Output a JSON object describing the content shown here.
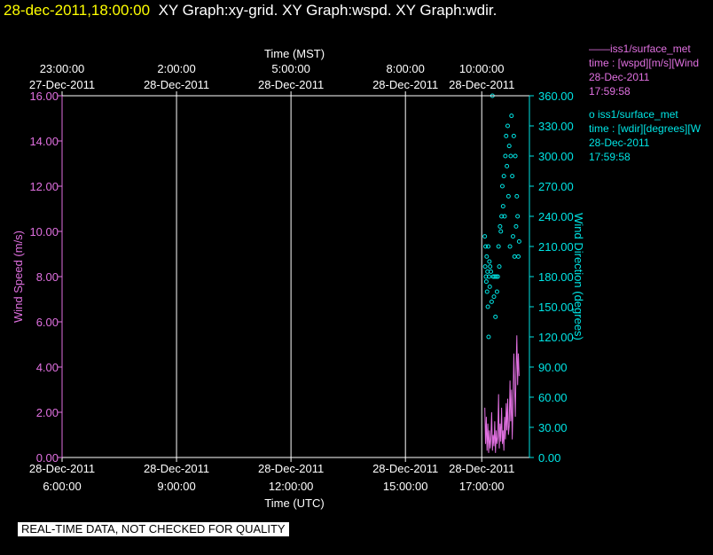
{
  "header": {
    "timestamp": "28-dec-2011,18:00:00",
    "title": "XY Graph:xy-grid.  XY Graph:wspd.  XY Graph:wdir."
  },
  "legend": [
    {
      "symbol": "line",
      "name": "——iss1/surface_met",
      "lines": [
        "time : [wspd][m/s][Wind",
        "28-Dec-2011",
        "17:59:58"
      ],
      "color": "#e070e0"
    },
    {
      "symbol": "circle",
      "name": "o  iss1/surface_met",
      "lines": [
        "time : [wdir][degrees][W",
        "28-Dec-2011",
        "17:59:58"
      ],
      "color": "#00e5e5"
    }
  ],
  "disclaimer": "REAL-TIME DATA, NOT CHECKED FOR QUALITY",
  "chart_data": {
    "type": "scatter",
    "title": "",
    "xlabel_top": "Time (MST)",
    "xlabel_bottom": "Time (UTC)",
    "ylabel_left": "Wind Speed (m/s)",
    "ylabel_right": "Wind Direction (degrees)",
    "xlim_utc_hours": [
      6,
      18.25
    ],
    "ylim_left": [
      0,
      16
    ],
    "ylim_right": [
      0,
      360
    ],
    "yticks_left": [
      "0.00",
      "2.00",
      "4.00",
      "6.00",
      "8.00",
      "10.00",
      "12.00",
      "14.00",
      "16.00"
    ],
    "yticks_right": [
      "0.00",
      "30.00",
      "60.00",
      "90.00",
      "120.00",
      "150.00",
      "180.00",
      "210.00",
      "240.00",
      "270.00",
      "300.00",
      "330.00",
      "360.00"
    ],
    "xticks_bottom": [
      {
        "hour": 6,
        "date": "28-Dec-2011",
        "time": "6:00:00"
      },
      {
        "hour": 9,
        "date": "28-Dec-2011",
        "time": "9:00:00"
      },
      {
        "hour": 12,
        "date": "28-Dec-2011",
        "time": "12:00:00"
      },
      {
        "hour": 15,
        "date": "28-Dec-2011",
        "time": "15:00:00"
      },
      {
        "hour": 17,
        "date": "28-Dec-2011",
        "time": "17:00:00"
      }
    ],
    "xticks_top": [
      {
        "hour": 6,
        "time": "23:00:00",
        "date": "27-Dec-2011"
      },
      {
        "hour": 9,
        "time": "2:00:00",
        "date": "28-Dec-2011"
      },
      {
        "hour": 12,
        "time": "5:00:00",
        "date": "28-Dec-2011"
      },
      {
        "hour": 15,
        "time": "8:00:00",
        "date": "28-Dec-2011"
      },
      {
        "hour": 17,
        "time": "10:00:00",
        "date": "28-Dec-2011"
      }
    ],
    "grid": true,
    "series": [
      {
        "name": "iss1/surface_met time : [wspd][m/s]",
        "axis": "left",
        "mode": "line",
        "color": "#e070e0",
        "x": [
          17.08,
          17.1,
          17.12,
          17.14,
          17.16,
          17.18,
          17.2,
          17.22,
          17.24,
          17.26,
          17.28,
          17.3,
          17.32,
          17.34,
          17.36,
          17.38,
          17.4,
          17.42,
          17.44,
          17.46,
          17.48,
          17.5,
          17.52,
          17.54,
          17.56,
          17.58,
          17.6,
          17.62,
          17.64,
          17.66,
          17.68,
          17.7,
          17.72,
          17.74,
          17.76,
          17.78,
          17.8,
          17.82,
          17.84,
          17.86,
          17.88,
          17.9,
          17.92,
          17.94,
          17.96,
          17.98
        ],
        "y": [
          2.2,
          0.6,
          1.8,
          0.3,
          1.5,
          0.2,
          1.2,
          0.4,
          0.8,
          2.0,
          0.3,
          1.0,
          0.5,
          1.6,
          0.2,
          1.2,
          0.6,
          0.9,
          2.8,
          0.4,
          1.5,
          0.7,
          2.2,
          0.6,
          1.2,
          0.3,
          1.8,
          0.8,
          2.4,
          1.2,
          2.6,
          1.0,
          1.4,
          3.4,
          1.6,
          3.0,
          0.8,
          2.4,
          4.6,
          3.2,
          1.8,
          3.8,
          5.4,
          3.2,
          4.6,
          3.6
        ]
      },
      {
        "name": "iss1/surface_met time : [wdir][degrees]",
        "axis": "right",
        "mode": "markers",
        "color": "#00e5e5",
        "x": [
          17.08,
          17.09,
          17.1,
          17.11,
          17.12,
          17.13,
          17.14,
          17.15,
          17.16,
          17.17,
          17.18,
          17.19,
          17.2,
          17.21,
          17.22,
          17.24,
          17.26,
          17.28,
          17.3,
          17.32,
          17.34,
          17.36,
          17.38,
          17.4,
          17.42,
          17.44,
          17.46,
          17.48,
          17.5,
          17.52,
          17.54,
          17.56,
          17.58,
          17.6,
          17.62,
          17.64,
          17.66,
          17.68,
          17.7,
          17.72,
          17.74,
          17.76,
          17.78,
          17.8,
          17.82,
          17.84,
          17.86,
          17.88,
          17.9,
          17.92,
          17.94,
          17.96,
          17.98
        ],
        "y": [
          220,
          190,
          210,
          180,
          175,
          200,
          165,
          185,
          150,
          210,
          120,
          180,
          195,
          170,
          190,
          185,
          155,
          360,
          180,
          160,
          180,
          140,
          180,
          165,
          180,
          210,
          190,
          230,
          225,
          240,
          270,
          250,
          280,
          240,
          300,
          320,
          290,
          330,
          260,
          310,
          210,
          300,
          340,
          280,
          220,
          320,
          200,
          300,
          230,
          260,
          240,
          200,
          215
        ]
      }
    ]
  }
}
